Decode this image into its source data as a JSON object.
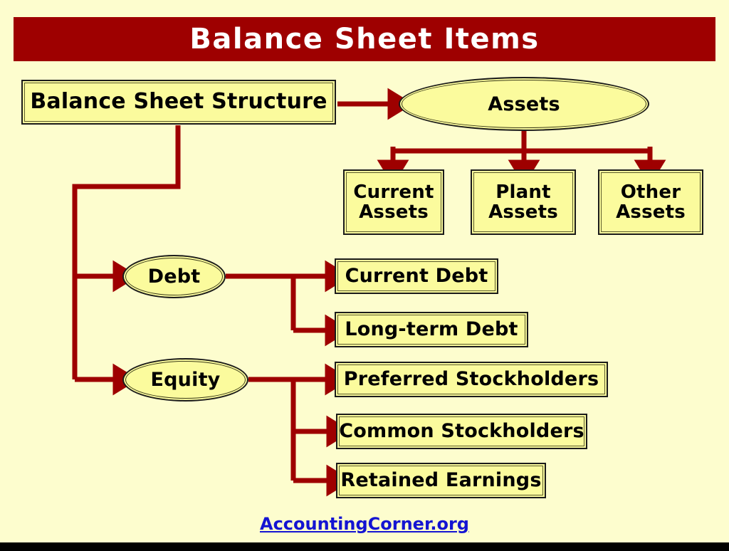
{
  "slide": {
    "title": "Balance Sheet Items",
    "background_color": "#fdfdce",
    "banner_color": "#9e0000",
    "node_fill_color": "#fbfb9d",
    "connector_color": "#9e0000",
    "link_color": "#1414d2"
  },
  "nodes": {
    "root": {
      "label": "Balance Sheet Structure",
      "shape": "rectangle"
    },
    "assets": {
      "label": "Assets",
      "shape": "ellipse"
    },
    "current_assets": {
      "label": "Current\nAssets",
      "shape": "rectangle"
    },
    "plant_assets": {
      "label": "Plant\nAssets",
      "shape": "rectangle"
    },
    "other_assets": {
      "label": "Other\nAssets",
      "shape": "rectangle"
    },
    "debt": {
      "label": "Debt",
      "shape": "ellipse"
    },
    "equity": {
      "label": "Equity",
      "shape": "ellipse"
    },
    "current_debt": {
      "label": "Current Debt",
      "shape": "rectangle"
    },
    "longterm_debt": {
      "label": "Long-term Debt",
      "shape": "rectangle"
    },
    "preferred_stockholders": {
      "label": "Preferred Stockholders",
      "shape": "rectangle"
    },
    "common_stockholders": {
      "label": "Common Stockholders",
      "shape": "rectangle"
    },
    "retained_earnings": {
      "label": "Retained Earnings",
      "shape": "rectangle"
    }
  },
  "edges": [
    {
      "from": "root",
      "to": "assets"
    },
    {
      "from": "root",
      "to": "debt"
    },
    {
      "from": "root",
      "to": "equity"
    },
    {
      "from": "assets",
      "to": "current_assets"
    },
    {
      "from": "assets",
      "to": "plant_assets"
    },
    {
      "from": "assets",
      "to": "other_assets"
    },
    {
      "from": "debt",
      "to": "current_debt"
    },
    {
      "from": "debt",
      "to": "longterm_debt"
    },
    {
      "from": "equity",
      "to": "preferred_stockholders"
    },
    {
      "from": "equity",
      "to": "common_stockholders"
    },
    {
      "from": "equity",
      "to": "retained_earnings"
    }
  ],
  "footer": {
    "link_text": "AccountingCorner.org"
  }
}
